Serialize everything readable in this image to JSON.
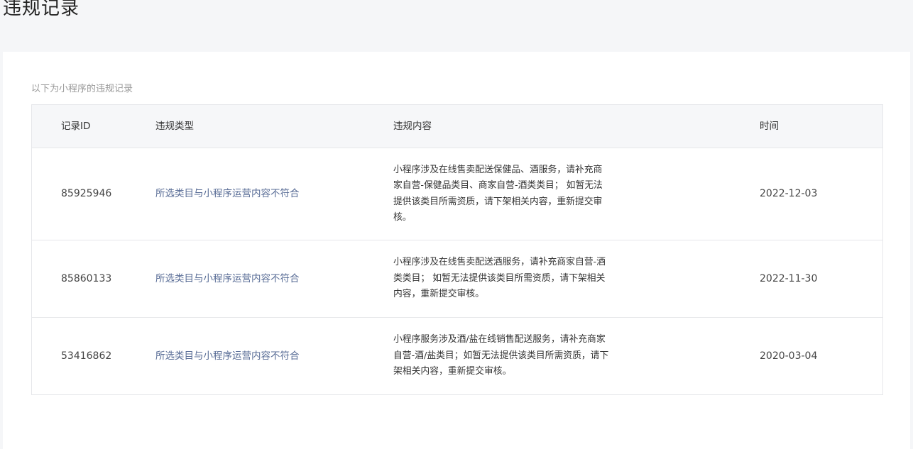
{
  "page": {
    "title": "违规记录"
  },
  "card": {
    "intro": "以下为小程序的违规记录"
  },
  "table": {
    "headers": {
      "id": "记录ID",
      "type": "违规类型",
      "content": "违规内容",
      "time": "时间"
    },
    "rows": [
      {
        "id": "85925946",
        "type": "所选类目与小程序运营内容不符合",
        "content": "小程序涉及在线售卖配送保健品、酒服务，请补充商家自营-保健品类目、商家自营-酒类类目； 如暂无法提供该类目所需资质，请下架相关内容，重新提交审核。",
        "time": "2022-12-03"
      },
      {
        "id": "85860133",
        "type": "所选类目与小程序运营内容不符合",
        "content": "小程序涉及在线售卖配送酒服务，请补充商家自营-酒类类目； 如暂无法提供该类目所需资质，请下架相关内容，重新提交审核。",
        "time": "2022-11-30"
      },
      {
        "id": "53416862",
        "type": "所选类目与小程序运营内容不符合",
        "content": "小程序服务涉及酒/盐在线销售配送服务，请补充商家自营-酒/盐类目；如暂无法提供该类目所需资质，请下架相关内容，重新提交审核。",
        "time": "2020-03-04"
      }
    ]
  },
  "colors": {
    "page_bg": "#f5f6f8",
    "card_bg": "#ffffff",
    "header_bg": "#f6f7f9",
    "link": "#576b95",
    "muted": "#999999",
    "border": "#e6e7ea"
  }
}
